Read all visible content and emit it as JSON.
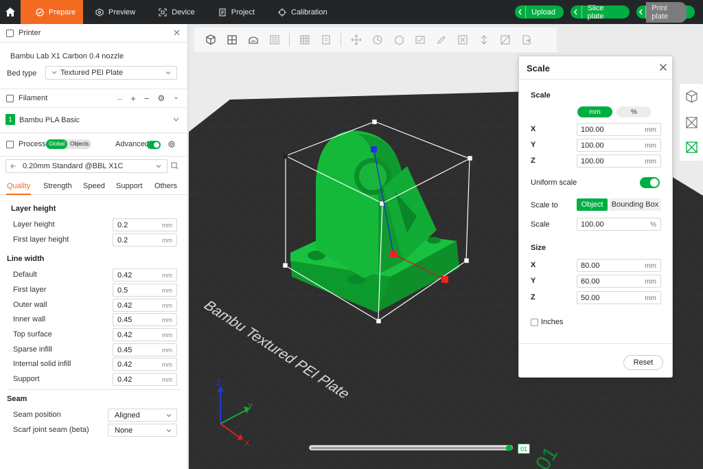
{
  "topbar": {
    "tabs": [
      {
        "label": "Prepare",
        "icon": "prepare-icon"
      },
      {
        "label": "Preview",
        "icon": "preview-icon"
      },
      {
        "label": "Device",
        "icon": "device-icon"
      },
      {
        "label": "Project",
        "icon": "project-icon"
      },
      {
        "label": "Calibration",
        "icon": "calibration-icon"
      }
    ],
    "actions": {
      "upload": "Upload",
      "slice": "Slice plate",
      "print": "Print plate"
    },
    "accent": "#f26b21",
    "green": "#00ae42"
  },
  "printer": {
    "title": "Printer",
    "name": "Bambu Lab X1 Carbon 0.4 nozzle",
    "bed_type_label": "Bed type",
    "bed_type_value": "Textured PEI Plate"
  },
  "filament": {
    "title": "Filament",
    "slot": "1",
    "name": "Bambu PLA Basic"
  },
  "process": {
    "title": "Process",
    "global": "Global",
    "objects": "Objects",
    "advanced": "Advanced",
    "preset": "0.20mm Standard @BBL X1C",
    "tabs": [
      "Quality",
      "Speed",
      "Support",
      "Others"
    ],
    "strength_tab": "Strength"
  },
  "quality": {
    "layer_height_title": "Layer height",
    "layer_height": {
      "label": "Layer height",
      "value": "0.2",
      "unit": "mm"
    },
    "first_layer_height": {
      "label": "First layer height",
      "value": "0.2",
      "unit": "mm"
    },
    "line_width_title": "Line width",
    "line_width": [
      {
        "label": "Default",
        "value": "0.42",
        "unit": "mm"
      },
      {
        "label": "First layer",
        "value": "0.5",
        "unit": "mm"
      },
      {
        "label": "Outer wall",
        "value": "0.42",
        "unit": "mm"
      },
      {
        "label": "Inner wall",
        "value": "0.45",
        "unit": "mm"
      },
      {
        "label": "Top surface",
        "value": "0.42",
        "unit": "mm"
      },
      {
        "label": "Sparse infill",
        "value": "0.45",
        "unit": "mm"
      },
      {
        "label": "Internal solid infill",
        "value": "0.42",
        "unit": "mm"
      },
      {
        "label": "Support",
        "value": "0.42",
        "unit": "mm"
      }
    ],
    "seam_title": "Seam",
    "seam_position": {
      "label": "Seam position",
      "value": "Aligned"
    },
    "scarf_seam": {
      "label": "Scarf joint seam (beta)",
      "value": "None"
    }
  },
  "viewport": {
    "plate_label": "Bambu Textured PEI Plate",
    "plate_number": "01",
    "axis_x": "X",
    "axis_y": "Y",
    "axis_z": "Z",
    "model_color": "#14b93a",
    "layer_slider_value": "01"
  },
  "scale_dialog": {
    "title": "Scale",
    "scale_section": "Scale",
    "unit_mm": "mm",
    "unit_pct": "%",
    "scale_x": {
      "axis": "X",
      "value": "100.00",
      "unit": "mm"
    },
    "scale_y": {
      "axis": "Y",
      "value": "100.00",
      "unit": "mm"
    },
    "scale_z": {
      "axis": "Z",
      "value": "100.00",
      "unit": "mm"
    },
    "uniform_scale": "Uniform scale",
    "scale_to": "Scale to",
    "scale_to_object": "Object",
    "scale_to_bbox": "Bounding Box",
    "scale_label": "Scale",
    "scale_value": "100.00",
    "scale_unit": "%",
    "size_section": "Size",
    "size_x": {
      "axis": "X",
      "value": "80.00",
      "unit": "mm"
    },
    "size_y": {
      "axis": "Y",
      "value": "60.00",
      "unit": "mm"
    },
    "size_z": {
      "axis": "Z",
      "value": "50.00",
      "unit": "mm"
    },
    "inches": "Inches",
    "reset": "Reset"
  }
}
